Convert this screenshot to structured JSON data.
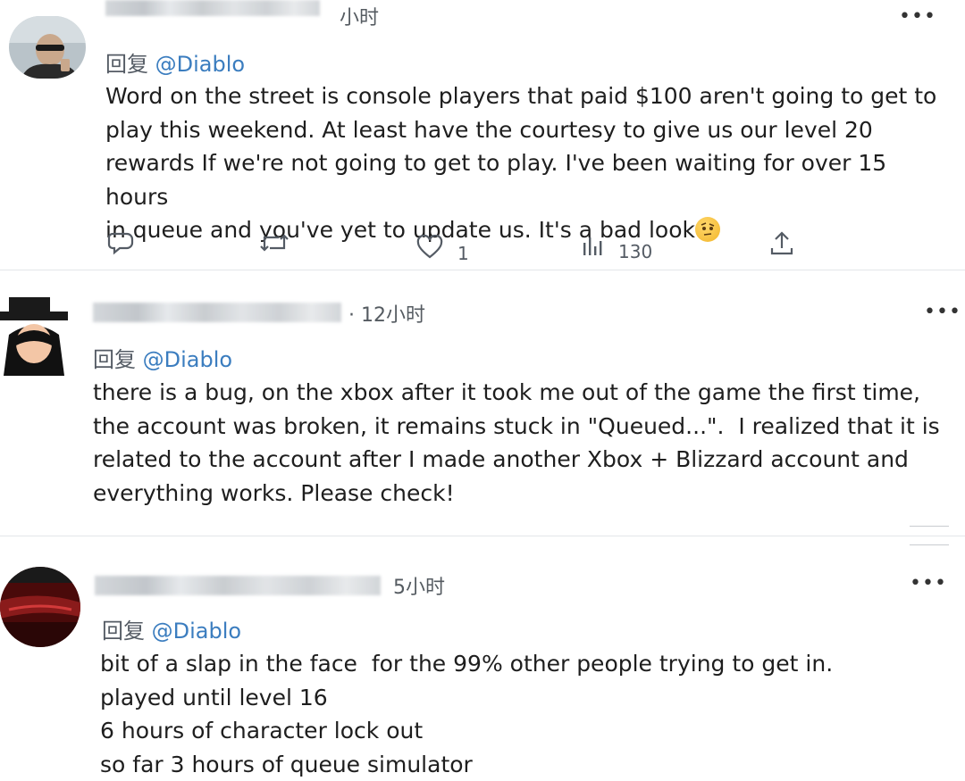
{
  "tweets": [
    {
      "timestamp": "小时",
      "reply_label": "回复",
      "mention": "@Diablo",
      "body": "Word on the street is console players that paid $100 aren't going to get to\nplay this weekend. At least have the courtesy to give us our level 20\nrewards If we're not going to get to play. I've been waiting for over 15 hours\nin queue and you've yet to update us. It's a bad look",
      "emoji": "face-with-raised-eyebrow",
      "actions": {
        "reply_icon": "reply-icon",
        "retweet_icon": "retweet-icon",
        "like_icon": "heart-icon",
        "like_count": "1",
        "views_icon": "views-icon",
        "views_count": "130",
        "share_icon": "share-icon"
      }
    },
    {
      "timestamp": "· 12小时",
      "reply_label": "回复",
      "mention": "@Diablo",
      "body": "there is a bug, on the xbox after it took me out of the game the first time,\nthe account was broken, it remains stuck in \"Queued...\".  I realized that it is\nrelated to the account after I made another Xbox + Blizzard account and\neverything works. Please check!"
    },
    {
      "timestamp": "5小时",
      "reply_label": "回复",
      "mention": "@Diablo",
      "body": "bit of a slap in the face  for the 99% other people trying to get in.\nplayed until level 16\n6 hours of character lock out\nso far 3 hours of queue simulator"
    }
  ],
  "more_label": "•••",
  "colors": {
    "mention": "#3b7dbf",
    "text": "#1e1e1e",
    "muted": "#545b64",
    "divider": "#e3e6e9"
  }
}
